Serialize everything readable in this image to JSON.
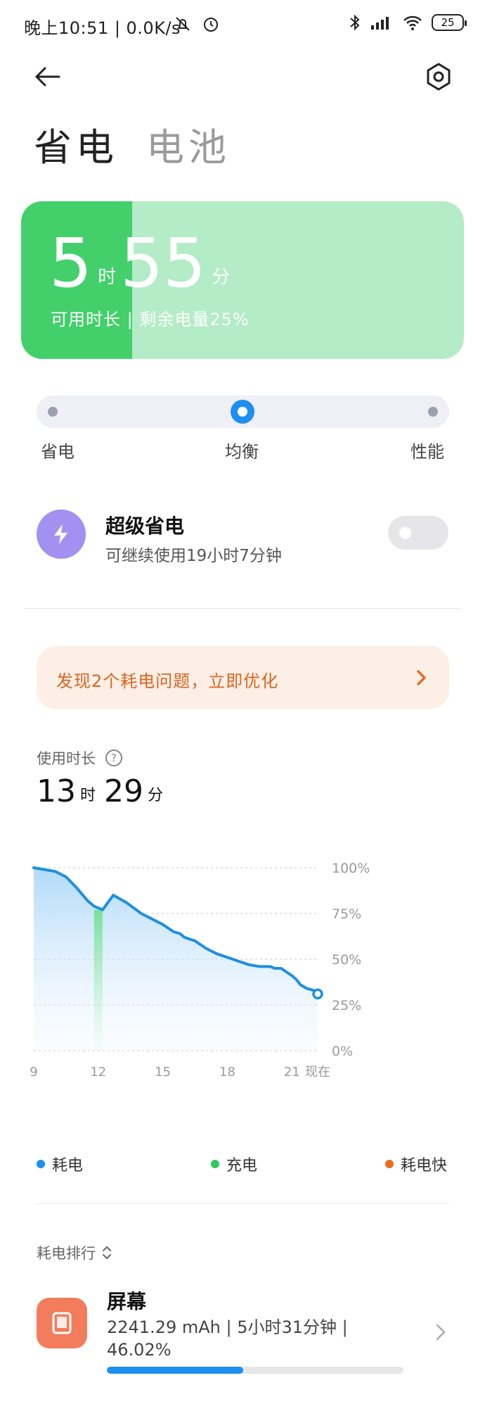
{
  "status_bar": {
    "time": "晚上10:51",
    "network_speed": "0.0K/s",
    "battery_level": "25",
    "icons": [
      "bell-off-icon",
      "alarm-icon",
      "bluetooth-icon",
      "hd-signal-icon",
      "wifi-icon",
      "battery-icon"
    ]
  },
  "header": {
    "back_icon": "back-arrow-icon",
    "settings_icon": "settings-hex-icon",
    "tabs": [
      {
        "label": "省电",
        "active": true
      },
      {
        "label": "电池",
        "active": false
      }
    ]
  },
  "battery_card": {
    "hours": "5",
    "hour_unit": "时",
    "minutes": "55",
    "minute_unit": "分",
    "subtitle": "可用时长 | 剩余电量25%",
    "remaining_fraction": 0.25,
    "fill_color": "#43d06a",
    "bg_color": "#b3ecc6"
  },
  "mode_slider": {
    "options": [
      "省电",
      "均衡",
      "性能"
    ],
    "selected": "均衡"
  },
  "super_saving": {
    "title": "超级省电",
    "subtitle": "可继续使用19小时7分钟",
    "enabled": false,
    "icon": "lightning-icon"
  },
  "optimize_banner": {
    "text": "发现2个耗电问题，立即优化",
    "icon": "chevron-right-icon",
    "color": "#d9661f"
  },
  "usage": {
    "label": "使用时长",
    "hours": "13",
    "hour_unit": "时",
    "minutes": "29",
    "minute_unit": "分",
    "help_icon": "question-icon"
  },
  "chart_data": {
    "type": "area",
    "x": [
      9,
      9.5,
      10,
      10.5,
      11,
      11.5,
      11.8,
      12.2,
      12.7,
      13.3,
      14,
      14.5,
      15,
      15.5,
      15.8,
      16,
      16.5,
      17,
      17.5,
      18,
      18.5,
      19,
      19.5,
      20,
      20.2,
      20.5,
      21,
      21.2,
      21.4,
      21.7,
      22,
      22.2
    ],
    "series": [
      {
        "values": [
          100,
          99,
          98,
          95,
          89,
          82,
          79,
          77,
          85,
          81,
          75,
          72,
          69,
          65,
          64,
          62,
          60,
          56,
          53,
          51,
          49,
          47,
          46,
          46,
          45,
          45,
          41,
          39,
          36,
          34,
          33,
          31,
          27
        ],
        "color": "#1e90e0"
      }
    ],
    "charging_interval": [
      11.8,
      12.2
    ],
    "x_ticks": [
      "9",
      "12",
      "15",
      "18",
      "21",
      "现在"
    ],
    "y_ticks": [
      "100%",
      "75%",
      "50%",
      "25%",
      "0%"
    ],
    "ylim": [
      0,
      100
    ],
    "xlim": [
      9,
      22.2
    ],
    "grid": true,
    "legend": [
      {
        "label": "耗电",
        "color": "#1e8ff0"
      },
      {
        "label": "充电",
        "color": "#2dc85c"
      },
      {
        "label": "耗电快",
        "color": "#f06a1e"
      }
    ]
  },
  "ranking": {
    "label": "耗电排行",
    "sort_icon": "sort-updown-icon",
    "items": [
      {
        "name": "屏幕",
        "stats": "2241.29 mAh | 5小时31分钟 | 46.02%",
        "share": 0.4602,
        "icon": "screen-phone-icon",
        "icon_color": "#f27c5c"
      }
    ]
  }
}
